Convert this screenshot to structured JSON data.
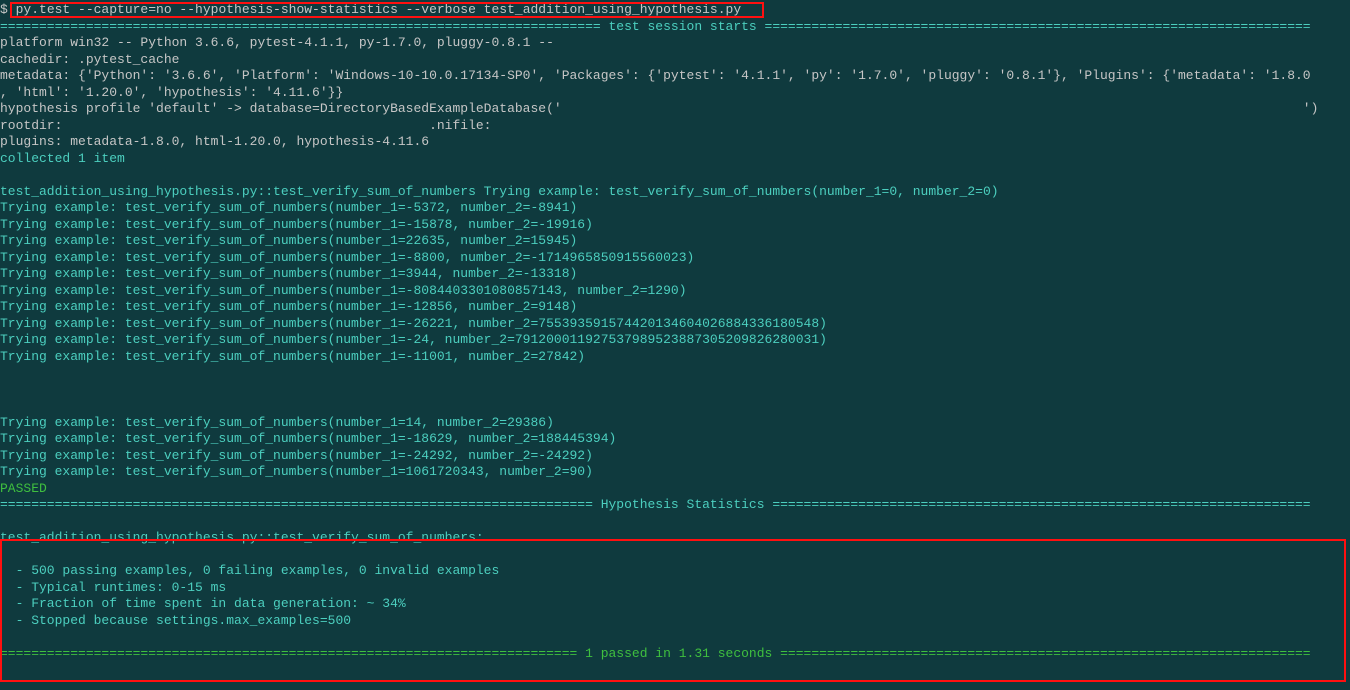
{
  "prompt_symbol": "$ ",
  "command": "py.test --capture=no --hypothesis-show-statistics --verbose test_addition_using_hypothesis.py",
  "session_header": "============================================================================= test session starts ======================================================================",
  "platform_line": "platform win32 -- Python 3.6.6, pytest-4.1.1, py-1.7.0, pluggy-0.8.1 --",
  "cachedir_line": "cachedir: .pytest_cache",
  "metadata_line1": "metadata: {'Python': '3.6.6', 'Platform': 'Windows-10-10.0.17134-SP0', 'Packages': {'pytest': '4.1.1', 'py': '1.7.0', 'pluggy': '0.8.1'}, 'Plugins': {'metadata': '1.8.0",
  "metadata_line2": ", 'html': '1.20.0', 'hypothesis': '4.11.6'}}",
  "hypothesis_profile": "hypothesis profile 'default' -> database=DirectoryBasedExampleDatabase('                                                                                               ')",
  "rootdir_line": "rootdir:                                               .nifile:",
  "plugins_line": "plugins: metadata-1.8.0, html-1.20.0, hypothesis-4.11.6",
  "collected_line": "collected 1 item",
  "test_first_line": "test_addition_using_hypothesis.py::test_verify_sum_of_numbers Trying example: test_verify_sum_of_numbers(number_1=0, number_2=0)",
  "examples_block1": [
    "Trying example: test_verify_sum_of_numbers(number_1=-5372, number_2=-8941)",
    "Trying example: test_verify_sum_of_numbers(number_1=-15878, number_2=-19916)",
    "Trying example: test_verify_sum_of_numbers(number_1=22635, number_2=15945)",
    "Trying example: test_verify_sum_of_numbers(number_1=-8800, number_2=-1714965850915560023)",
    "Trying example: test_verify_sum_of_numbers(number_1=3944, number_2=-13318)",
    "Trying example: test_verify_sum_of_numbers(number_1=-8084403301080857143, number_2=1290)",
    "Trying example: test_verify_sum_of_numbers(number_1=-12856, number_2=9148)",
    "Trying example: test_verify_sum_of_numbers(number_1=-26221, number_2=755393591574420134604026884336180548)",
    "Trying example: test_verify_sum_of_numbers(number_1=-24, number_2=791200011927537989523887305209826280031)",
    "Trying example: test_verify_sum_of_numbers(number_1=-11001, number_2=27842)"
  ],
  "examples_block2": [
    "Trying example: test_verify_sum_of_numbers(number_1=14, number_2=29386)",
    "Trying example: test_verify_sum_of_numbers(number_1=-18629, number_2=188445394)",
    "Trying example: test_verify_sum_of_numbers(number_1=-24292, number_2=-24292)",
    "Trying example: test_verify_sum_of_numbers(number_1=1061720343, number_2=90)"
  ],
  "passed_word": "PASSED",
  "hypothesis_stats_header": "============================================================================ Hypothesis Statistics =====================================================================",
  "stats_title": "test_addition_using_hypothesis.py::test_verify_sum_of_numbers:",
  "stats_lines": [
    "  - 500 passing examples, 0 failing examples, 0 invalid examples",
    "  - Typical runtimes: 0-15 ms",
    "  - Fraction of time spent in data generation: ~ 34%",
    "  - Stopped because settings.max_examples=500"
  ],
  "footer_line": "========================================================================== 1 passed in 1.31 seconds ===================================================================="
}
